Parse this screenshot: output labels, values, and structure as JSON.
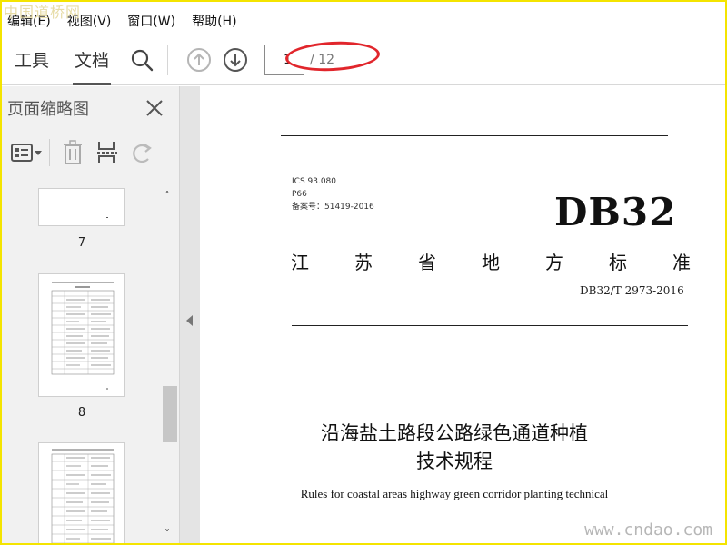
{
  "watermark": {
    "top": "中国道桥网",
    "bottom": "www.cndao.com"
  },
  "menu": [
    "编辑(E)",
    "视图(V)",
    "窗口(W)",
    "帮助(H)"
  ],
  "toolbar": {
    "tabs": [
      {
        "label": "工具",
        "active": false
      },
      {
        "label": "文档",
        "active": true
      }
    ],
    "icons": [
      "search-icon",
      "page-up-icon",
      "page-down-icon"
    ],
    "page_current": "1",
    "page_total": "/ 12"
  },
  "panel": {
    "title": "页面缩略图",
    "close_icon": "close-icon",
    "tools": [
      "thumbnail-options-icon",
      "delete-icon",
      "extract-pages-icon",
      "rotate-icon"
    ],
    "thumbs": [
      {
        "label": "7"
      },
      {
        "label": "8"
      }
    ]
  },
  "document": {
    "ics": "ICS 93.080",
    "p": "P66",
    "record": "备案号：51419-2016",
    "db": "DB32",
    "standard_name": [
      "江",
      "苏",
      "省",
      "地",
      "方",
      "标",
      "准"
    ],
    "standard_no": "DB32/T 2973-2016",
    "title_cn_line1": "沿海盐土路段公路绿色通道种植",
    "title_cn_line2": "技术规程",
    "title_en": "Rules for coastal areas highway green corridor planting technical"
  },
  "colors": {
    "frame": "#f4e400",
    "annotation": "#e1262c",
    "panel_bg": "#f1f1f1"
  }
}
